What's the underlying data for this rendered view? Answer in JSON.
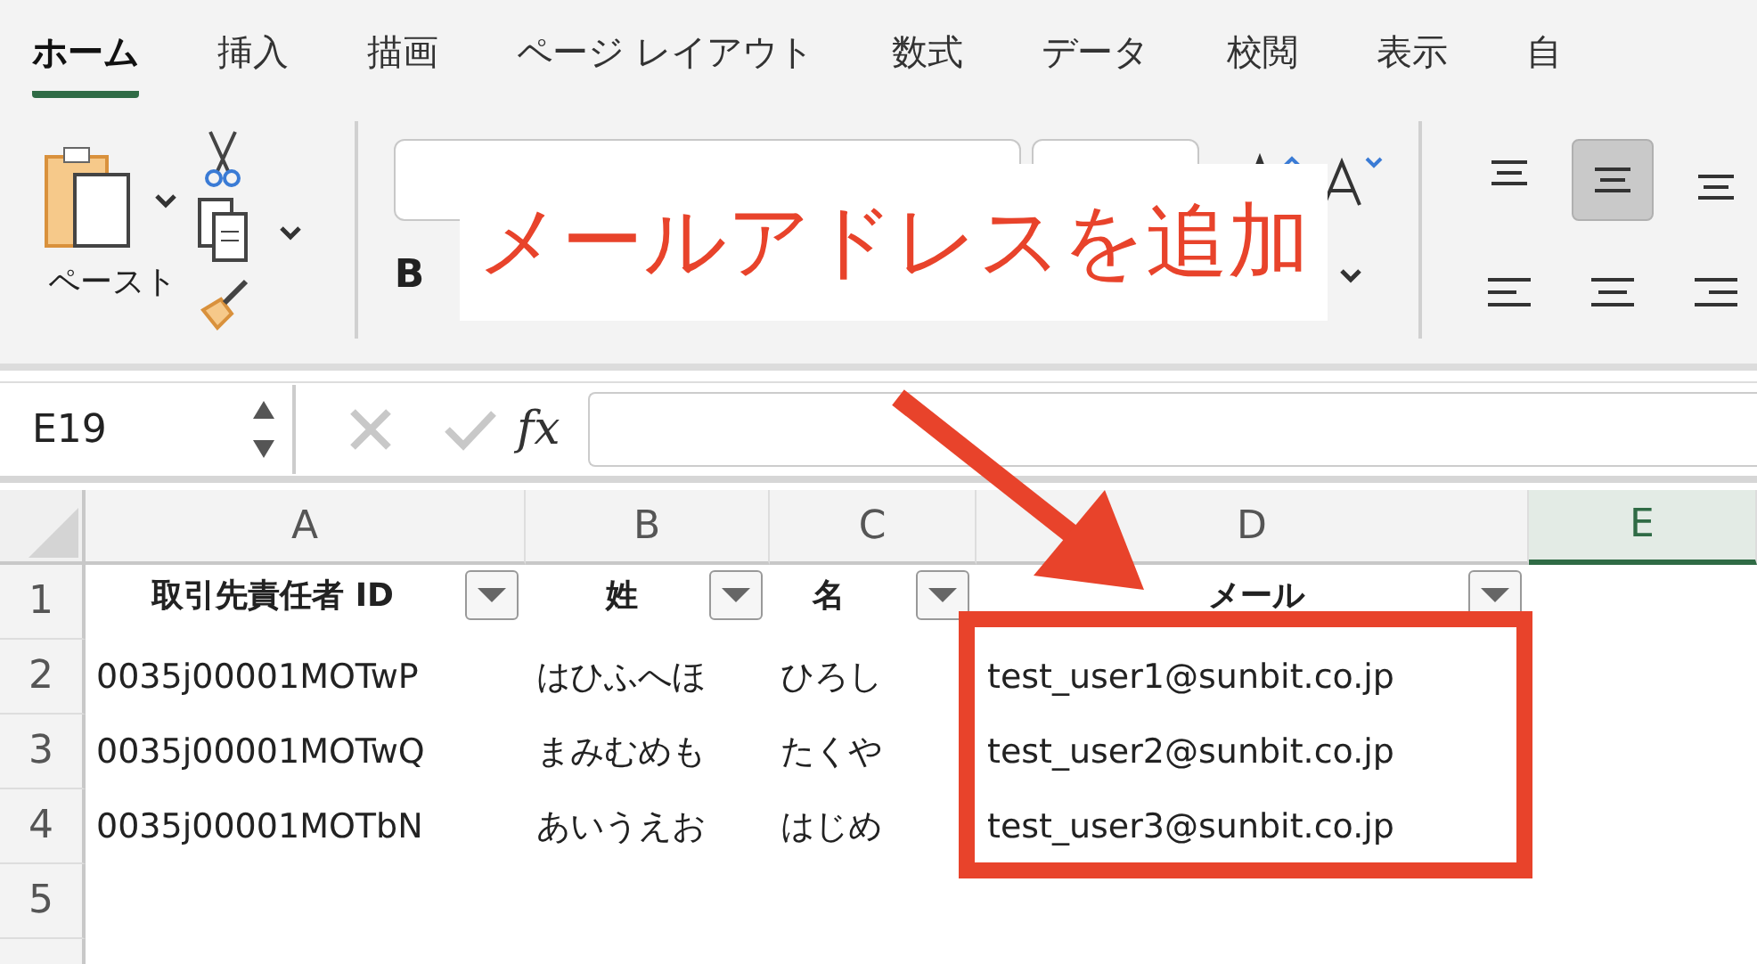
{
  "ribbon_tabs": [
    {
      "label": "ホーム",
      "selected": true
    },
    {
      "label": "挿入",
      "selected": false
    },
    {
      "label": "描画",
      "selected": false
    },
    {
      "label": "ページ レイアウト",
      "selected": false
    },
    {
      "label": "数式",
      "selected": false
    },
    {
      "label": "データ",
      "selected": false
    },
    {
      "label": "校閲",
      "selected": false
    },
    {
      "label": "表示",
      "selected": false
    },
    {
      "label": "自",
      "selected": false
    }
  ],
  "ribbon": {
    "paste_label": "ペースト",
    "bold_label": "B",
    "align_buttons": [
      {
        "selected": false
      },
      {
        "selected": true
      },
      {
        "selected": false
      },
      {
        "selected": false
      },
      {
        "selected": false
      },
      {
        "selected": false
      }
    ]
  },
  "formula_bar": {
    "name_box": "E19",
    "fx_label": "fx"
  },
  "sheet": {
    "columns": [
      {
        "label": "A",
        "selected": false
      },
      {
        "label": "B",
        "selected": false
      },
      {
        "label": "C",
        "selected": false
      },
      {
        "label": "D",
        "selected": false
      },
      {
        "label": "E",
        "selected": true
      }
    ],
    "row_numbers": [
      "1",
      "2",
      "3",
      "4",
      "5"
    ],
    "header_row": [
      "取引先責任者 ID",
      "姓",
      "名",
      "メール"
    ],
    "rows": [
      [
        "0035j00001MOTwP",
        "はひふへほ",
        "ひろし",
        "test_user1@sunbit.co.jp"
      ],
      [
        "0035j00001MOTwQ",
        "まみむめも",
        "たくや",
        "test_user2@sunbit.co.jp"
      ],
      [
        "0035j00001MOTbN",
        "あいうえお",
        "はじめ",
        "test_user3@sunbit.co.jp"
      ]
    ]
  },
  "callout": {
    "text": "メールアドレスを追加"
  }
}
